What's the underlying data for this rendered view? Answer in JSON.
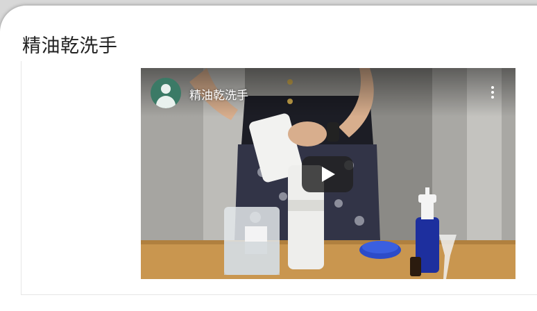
{
  "page": {
    "title": "精油乾洗手"
  },
  "video": {
    "title": "精油乾洗手",
    "menu_icon": "more-vert-icon",
    "play_icon": "play-icon",
    "avatar_icon": "channel-avatar-icon"
  },
  "colors": {
    "avatar": "#3b7a66",
    "play_button": "#212121"
  }
}
